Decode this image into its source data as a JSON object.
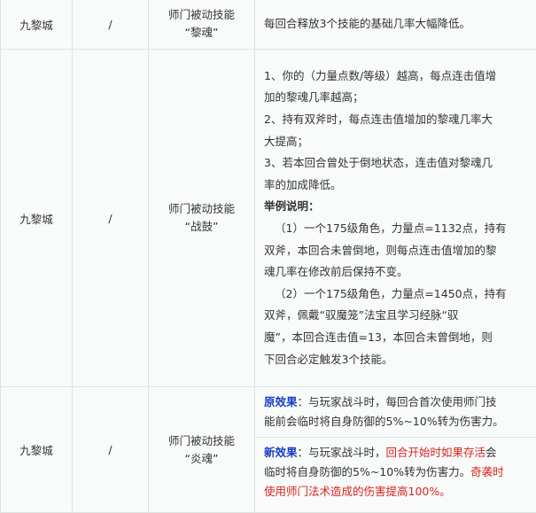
{
  "rows": [
    {
      "sect": "九黎城",
      "slash": "/",
      "skill": [
        "师门被动技能",
        "“黎魂”"
      ],
      "effect": "每回合释放3个技能的基础几率大幅降低。"
    },
    {
      "sect": "九黎城",
      "slash": "/",
      "skill": [
        "师门被动技能",
        "“战鼓”"
      ],
      "lines": [
        "1、你的（力量点数/等级）越高，每点连击值增",
        "加的黎魂几率越高；",
        "2、持有双斧时，每点连击值增加的黎魂几率大",
        "大提高；",
        "3、若本回合曾处于倒地状态，连击值对黎魂几",
        "率的加成降低。",
        "举例说明：",
        "（1）一个175级角色，力量点=1132点，持有",
        "双斧，本回合未曾倒地，则每点连击值增加的黎",
        "魂几率在修改前后保持不变。",
        "（2）一个175级角色，力量点=1450点，持有",
        "双斧，佩戴“驭魔笼”法宝且学习经脉“驭",
        "魔”，本回合连击值=13，本回合未曾倒地，则",
        "下回合必定触发3个技能。"
      ]
    },
    {
      "sect": "九黎城",
      "slash": "/",
      "skill": [
        "师门被动技能",
        "“炎魂”"
      ],
      "old": {
        "label": "原效果",
        "l1": "：与玩家战斗时，每回合首次使用师门技",
        "l2": "能前会临时将自身防御的5%~10%转为伤害力。"
      },
      "new": {
        "label": "新效果",
        "l1a": "：与玩家战斗时，",
        "l1red": "回合开始时如果存活",
        "l1b": "会",
        "l2a": "临时将自身防御的5%~10%转为伤害力。",
        "l2red": "奇袭时",
        "l3red": "使用师门法术造成的伤害提高100%。"
      }
    }
  ]
}
